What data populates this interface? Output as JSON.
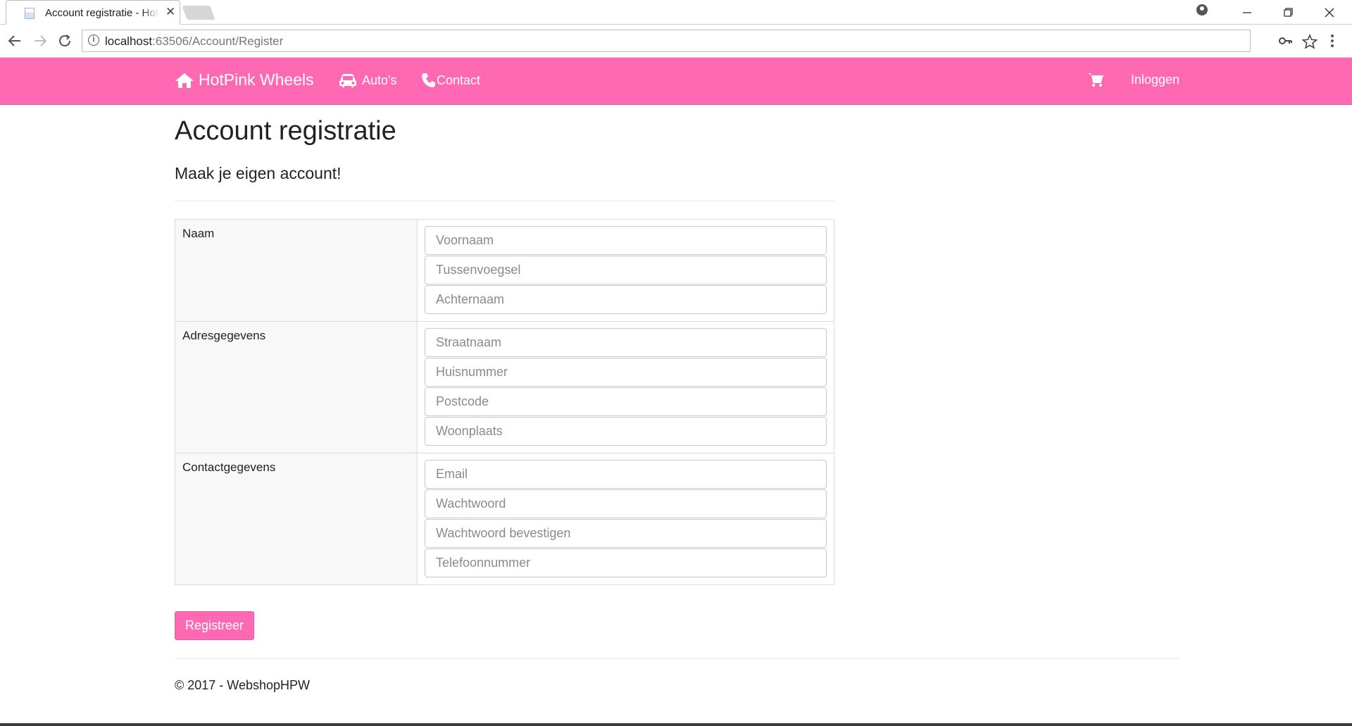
{
  "browser": {
    "tab_title": "Account registratie - HotPink Wheels",
    "tab_close": "✕",
    "url_host": "localhost",
    "url_rest": ":63506/Account/Register",
    "info_glyph": "i",
    "icons": [
      "back-arrow-icon",
      "forward-arrow-icon",
      "reload-icon",
      "info-icon",
      "key-icon",
      "star-icon",
      "menu-icon",
      "profile-icon",
      "minimize-icon",
      "restore-icon",
      "close-icon"
    ]
  },
  "navbar": {
    "brand": "HotPink Wheels",
    "links": [
      {
        "label": "Auto's",
        "icon": "car-icon"
      },
      {
        "label": "Contact",
        "icon": "phone-icon"
      }
    ],
    "cart_icon": "cart-icon",
    "login": "Inloggen",
    "color": "#ff69b4"
  },
  "page": {
    "title": "Account registratie",
    "subtitle": "Maak je eigen account!"
  },
  "form": {
    "sections": [
      {
        "label": "Naam",
        "fields": [
          "Voornaam",
          "Tussenvoegsel",
          "Achternaam"
        ]
      },
      {
        "label": "Adresgegevens",
        "fields": [
          "Straatnaam",
          "Huisnummer",
          "Postcode",
          "Woonplaats"
        ]
      },
      {
        "label": "Contactgegevens",
        "fields": [
          "Email",
          "Wachtwoord",
          "Wachtwoord bevestigen",
          "Telefoonnummer"
        ]
      }
    ],
    "submit": "Registreer"
  },
  "footer": "© 2017 - WebshopHPW"
}
